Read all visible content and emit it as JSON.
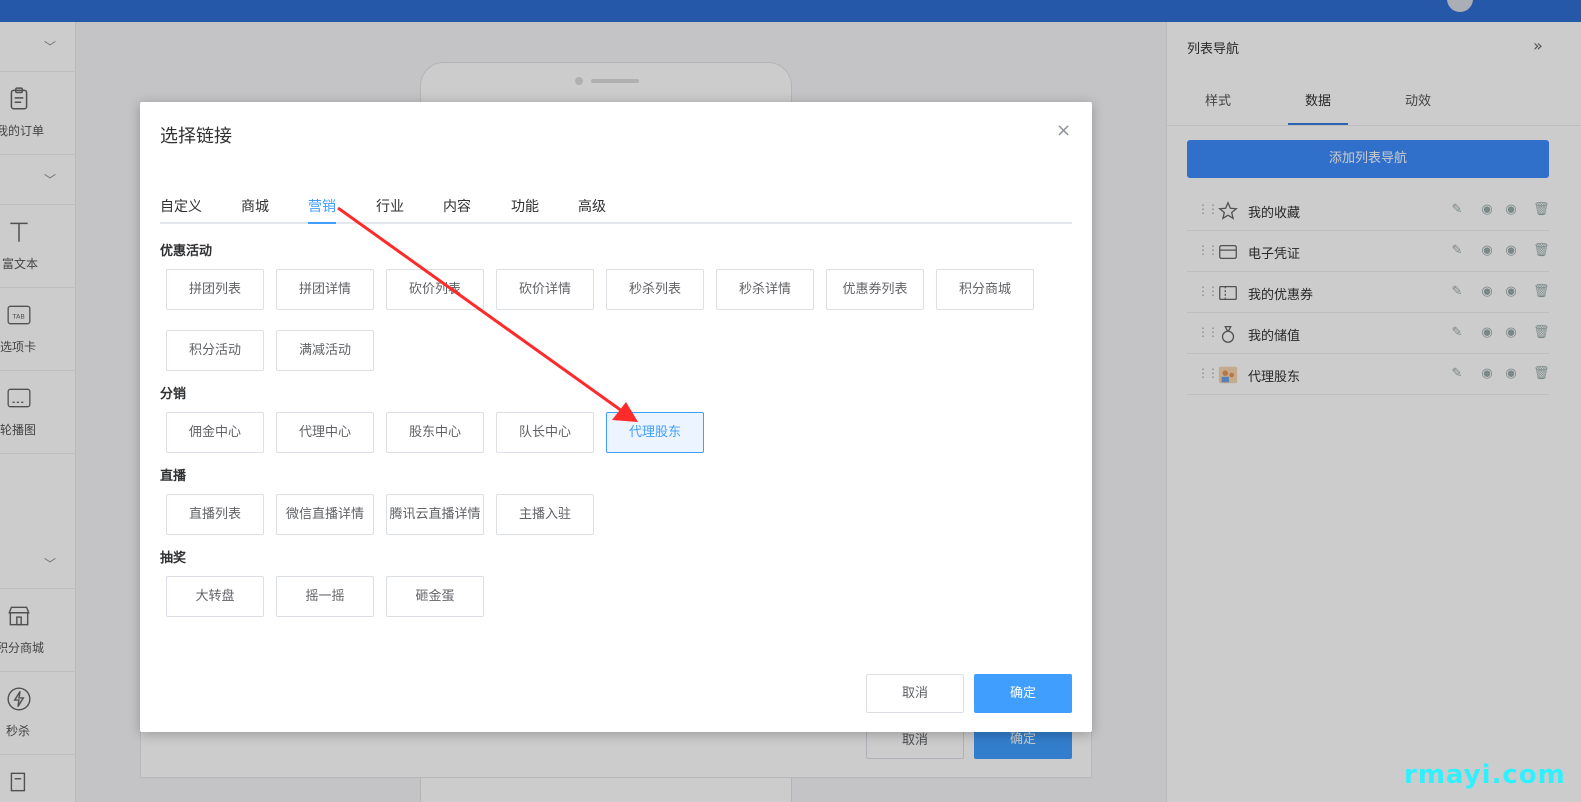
{
  "sidebar": {
    "items": [
      {
        "label": "我的订单",
        "icon": "clipboard-icon"
      },
      {
        "label": "富文本",
        "icon": "text-icon"
      },
      {
        "label": "选项卡",
        "icon": "tab-icon"
      },
      {
        "label": "轮播图",
        "icon": "carousel-icon"
      },
      {
        "label": "积分商城",
        "icon": "shop-icon"
      },
      {
        "label": "秒杀",
        "icon": "lightning-icon"
      }
    ]
  },
  "canvas": {
    "cancel_label": "取消",
    "ok_label": "确定"
  },
  "right_panel": {
    "title": "列表导航",
    "tabs": [
      "样式",
      "数据",
      "动效"
    ],
    "active_tab": "数据",
    "add_button": "添加列表导航",
    "rows": [
      {
        "label": "我的收藏",
        "icon": "star-icon"
      },
      {
        "label": "电子凭证",
        "icon": "wallet-icon"
      },
      {
        "label": "我的优惠券",
        "icon": "coupon-icon"
      },
      {
        "label": "我的储值",
        "icon": "money-bag-icon"
      },
      {
        "label": "代理股东",
        "icon": "agent-avatar-icon"
      }
    ]
  },
  "dialog": {
    "title": "选择链接",
    "close_glyph": "×",
    "tabs": [
      "自定义",
      "商城",
      "营销",
      "行业",
      "内容",
      "功能",
      "高级"
    ],
    "active_tab": "营销",
    "sections": [
      {
        "title": "优惠活动",
        "options": [
          "拼团列表",
          "拼团详情",
          "砍价列表",
          "砍价详情",
          "秒杀列表",
          "秒杀详情",
          "优惠券列表",
          "积分商城",
          "积分活动",
          "满减活动"
        ]
      },
      {
        "title": "分销",
        "options": [
          "佣金中心",
          "代理中心",
          "股东中心",
          "队长中心",
          "代理股东"
        ]
      },
      {
        "title": "直播",
        "options": [
          "直播列表",
          "微信直播详情",
          "腾讯云直播详情",
          "主播入驻"
        ]
      },
      {
        "title": "抽奖",
        "options": [
          "大转盘",
          "摇一摇",
          "砸金蛋"
        ]
      }
    ],
    "selected_option": "代理股东",
    "cancel_label": "取消",
    "ok_label": "确定"
  },
  "colors": {
    "primary": "#409eff",
    "topbar": "#2f6fd3",
    "annotation_arrow": "#ff2a2a",
    "watermark": "#2ff0ff"
  },
  "watermark": "rmayi.com"
}
